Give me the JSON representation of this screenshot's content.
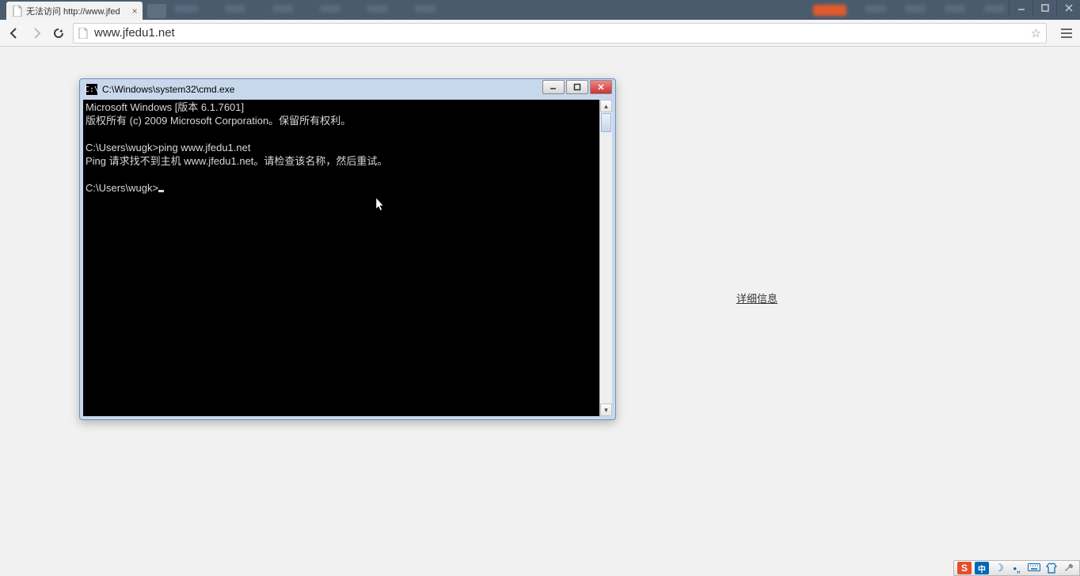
{
  "browser": {
    "tab": {
      "title": "无法访问 http://www.jfed"
    },
    "url": "www.jfedu1.net"
  },
  "page": {
    "details_link": "详细信息"
  },
  "cmd": {
    "title": "C:\\Windows\\system32\\cmd.exe",
    "lines": {
      "l1": "Microsoft Windows [版本 6.1.7601]",
      "l2": "版权所有 (c) 2009 Microsoft Corporation。保留所有权利。",
      "l3": "",
      "l4": "C:\\Users\\wugk>ping www.jfedu1.net",
      "l5": "Ping 请求找不到主机 www.jfedu1.net。请检查该名称，然后重试。",
      "l6": "",
      "l7": "C:\\Users\\wugk>"
    }
  },
  "ime": {
    "s": "S",
    "cn": "中"
  }
}
